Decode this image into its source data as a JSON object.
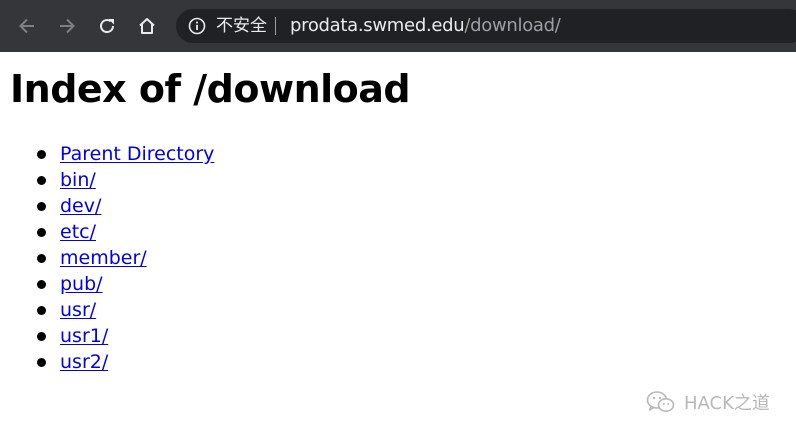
{
  "browser": {
    "back_icon": "arrow-left-icon",
    "forward_icon": "arrow-right-icon",
    "reload_icon": "reload-icon",
    "home_icon": "home-icon",
    "security_icon": "info-circle-icon",
    "security_label": "不安全",
    "url_host": "prodata.swmed.edu",
    "url_path": "/download/"
  },
  "page": {
    "title": "Index of /download",
    "entries": [
      {
        "label": "Parent Directory"
      },
      {
        "label": "bin/"
      },
      {
        "label": "dev/"
      },
      {
        "label": "etc/"
      },
      {
        "label": "member/"
      },
      {
        "label": "pub/"
      },
      {
        "label": "usr/"
      },
      {
        "label": "usr1/"
      },
      {
        "label": "usr2/"
      }
    ]
  },
  "watermark": {
    "icon": "wechat-icon",
    "text": "HACK之道"
  },
  "colors": {
    "toolbar_bg": "#35363a",
    "omnibox_bg": "#202124",
    "link": "#0000ee",
    "watermark": "#b8b8b8"
  }
}
